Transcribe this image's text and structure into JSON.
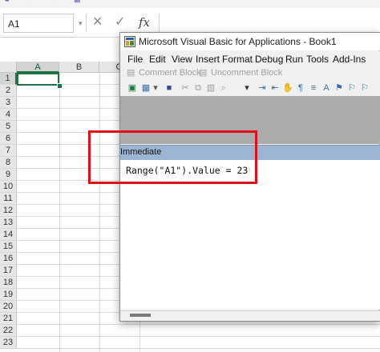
{
  "excel": {
    "name_box": "A1",
    "columns": [
      "A",
      "B",
      "C"
    ],
    "selected_column": "A",
    "rows": [
      "1",
      "2",
      "3",
      "4",
      "5",
      "6",
      "7",
      "8",
      "9",
      "10",
      "11",
      "12",
      "13",
      "14",
      "15",
      "16",
      "17",
      "18",
      "19",
      "20",
      "21",
      "22",
      "23"
    ],
    "selected_row": "1"
  },
  "formula_bar": {
    "cancel_icon": "✕",
    "enter_icon": "✓",
    "fx_label": "fx",
    "value": ""
  },
  "vba": {
    "window_title": "Microsoft Visual Basic for Applications - Book1",
    "menu": [
      "File",
      "Edit",
      "View",
      "Insert",
      "Format",
      "Debug",
      "Run",
      "Tools",
      "Add-Ins"
    ],
    "comment_block": "Comment Block",
    "uncomment_block": "Uncomment Block",
    "immediate_title": "Immediate",
    "immediate_text": "Range(\"A1\").Value = 23"
  },
  "colors": {
    "excel_green": "#217346",
    "highlight_red": "#e0101a",
    "immediate_title_bg": "#9bb5d3"
  }
}
